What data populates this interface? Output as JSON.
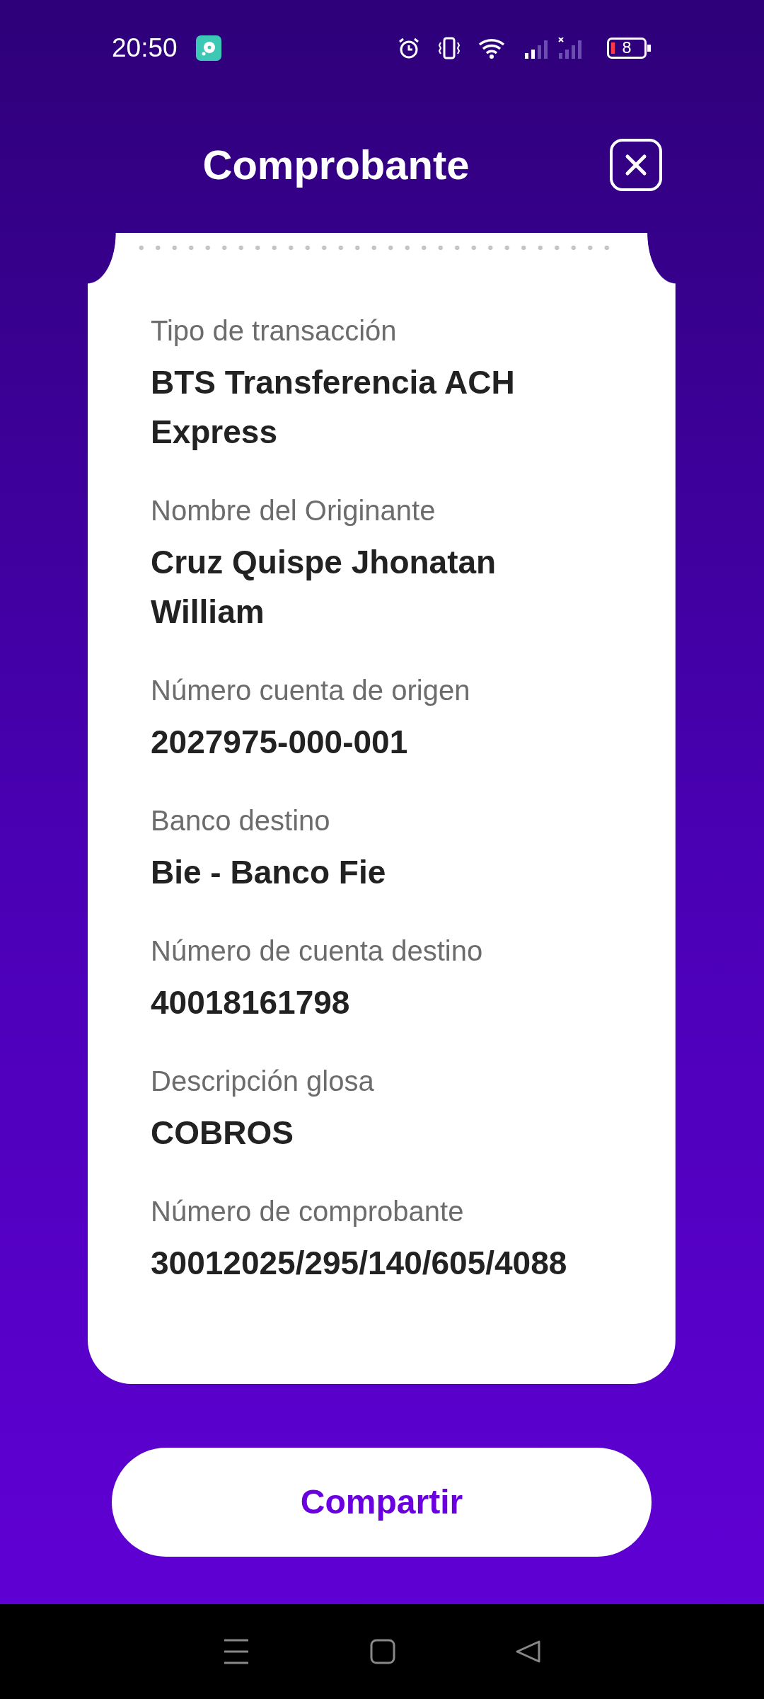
{
  "status_bar": {
    "time": "20:50",
    "battery": "8"
  },
  "header": {
    "title": "Comprobante"
  },
  "fields": [
    {
      "label": "Tipo de transacción",
      "value": "BTS Transferencia ACH Express"
    },
    {
      "label": "Nombre del Originante",
      "value": "Cruz Quispe Jhonatan William"
    },
    {
      "label": "Número cuenta de origen",
      "value": "2027975-000-001"
    },
    {
      "label": "Banco destino",
      "value": "Bie - Banco Fie"
    },
    {
      "label": "Número de cuenta destino",
      "value": "40018161798"
    },
    {
      "label": "Descripción glosa",
      "value": "COBROS"
    },
    {
      "label": "Número de comprobante",
      "value": "30012025/295/140/605/4088"
    }
  ],
  "share_button": "Compartir"
}
